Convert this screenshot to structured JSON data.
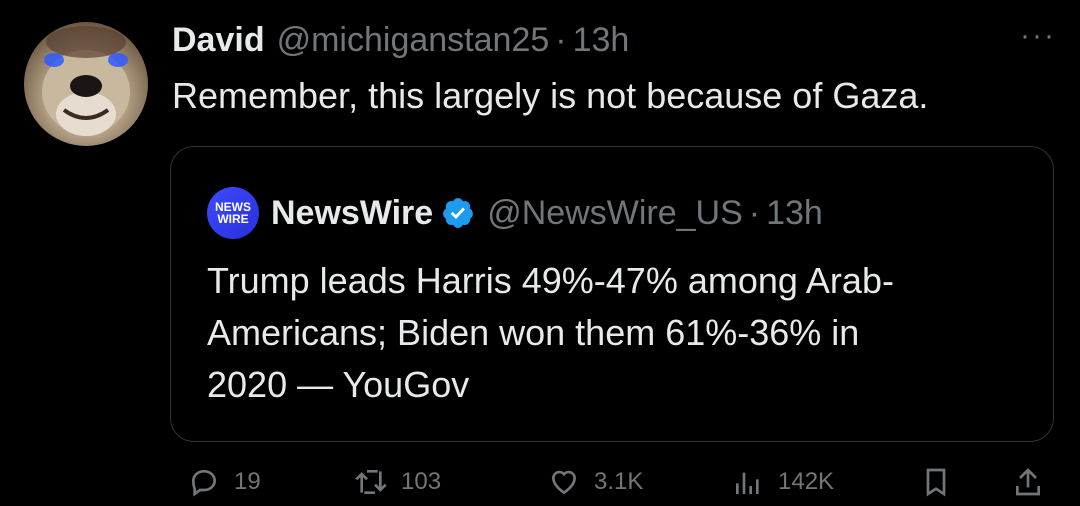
{
  "tweet": {
    "author_name": "David",
    "handle": "@michiganstan25",
    "separator": "·",
    "time": "13h",
    "more_label": "···",
    "text": "Remember, this largely is not because of Gaza."
  },
  "quote": {
    "logo_line1": "NEWS",
    "logo_line2": "WIRE",
    "author_name": "NewsWire",
    "handle": "@NewsWire_US",
    "separator": "·",
    "time": "13h",
    "text_lines": [
      "Trump leads Harris 49%-47% among Arab-",
      "Americans; Biden won them 61%-36% in",
      "2020 — YouGov"
    ]
  },
  "actions": {
    "replies": "19",
    "reposts": "103",
    "likes": "3.1K",
    "views": "142K"
  },
  "colors": {
    "background": "#000000",
    "text": "#e7e9ea",
    "muted": "#71767b",
    "border": "#2f3336",
    "verified": "#1d9bf0"
  },
  "icons": [
    "more-icon",
    "verified-badge-icon",
    "reply-icon",
    "repost-icon",
    "like-icon",
    "views-icon",
    "bookmark-icon",
    "share-icon"
  ]
}
